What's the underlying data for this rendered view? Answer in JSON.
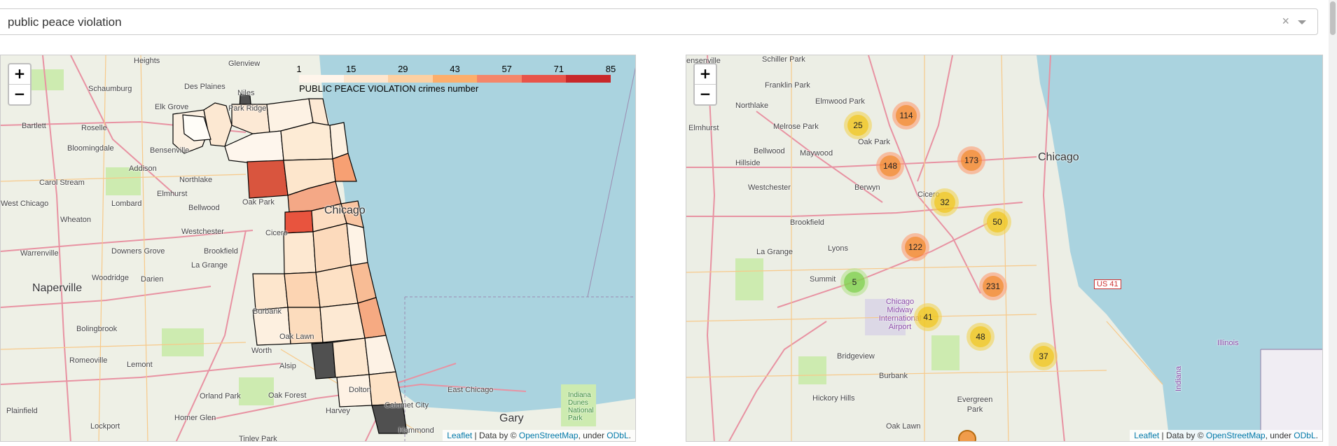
{
  "select": {
    "value": "public peace violation",
    "clear": "×"
  },
  "map_left": {
    "legend": {
      "ticks": [
        "1",
        "15",
        "29",
        "43",
        "57",
        "71",
        "85"
      ],
      "caption": "PUBLIC PEACE VIOLATION crimes number",
      "colors": [
        "#fff5eb",
        "#fee6ce",
        "#fdd0a2",
        "#fdae6b",
        "#f4866a",
        "#e8544a",
        "#c8282a"
      ]
    },
    "zoom_in": "+",
    "zoom_out": "−",
    "places": [
      "Heights",
      "Glenview",
      "Schaumburg",
      "Des Plaines",
      "Niles",
      "Bartlett",
      "Roselle",
      "Elk Grove",
      "Park Ridge",
      "Bloomingdale",
      "Bensenville",
      "Addison",
      "Carol Stream",
      "Northlake",
      "Elmhurst",
      "Oak Park",
      "West Chicago",
      "Lombard",
      "Bellwood",
      "Chicago",
      "Wheaton",
      "Westchester",
      "Cicero",
      "Warrenville",
      "Downers Grove",
      "Brookfield",
      "La Grange",
      "Naperville",
      "Woodridge",
      "Darien",
      "Burbank",
      "Bolingbrook",
      "Oak Lawn",
      "Romeoville",
      "Lemont",
      "Worth",
      "Orland Park",
      "Alsip",
      "Oak Forest",
      "Harvey",
      "Dolton",
      "East Chicago",
      "Calumet City",
      "Plainfield",
      "Lockport",
      "Homer Glen",
      "Gary",
      "Hammond",
      "Tinley Park",
      "Indiana Dunes National Park"
    ],
    "attribution": {
      "leaflet": "Leaflet",
      "mid": " | Data by © ",
      "osm": "OpenStreetMap",
      "under": ", under ",
      "odbl": "ODbL",
      "end": "."
    }
  },
  "map_right": {
    "zoom_in": "+",
    "zoom_out": "−",
    "clusters": [
      {
        "label": "25",
        "size": "med"
      },
      {
        "label": "114",
        "size": "large"
      },
      {
        "label": "148",
        "size": "large"
      },
      {
        "label": "173",
        "size": "large"
      },
      {
        "label": "32",
        "size": "med"
      },
      {
        "label": "50",
        "size": "med"
      },
      {
        "label": "122",
        "size": "large"
      },
      {
        "label": "5",
        "size": "small"
      },
      {
        "label": "231",
        "size": "large"
      },
      {
        "label": "41",
        "size": "med"
      },
      {
        "label": "48",
        "size": "med"
      },
      {
        "label": "37",
        "size": "med"
      }
    ],
    "places": [
      "ensenville",
      "Schiller Park",
      "Franklin Park",
      "Northlake",
      "Elmwood Park",
      "Melrose Park",
      "Elmhurst",
      "Oak Park",
      "Bellwood",
      "Maywood",
      "Hillside",
      "Chicago",
      "Westchester",
      "Berwyn",
      "Cicero",
      "Brookfield",
      "Lyons",
      "La Grange",
      "Summit",
      "Chicago Midway International Airport",
      "Bridgeview",
      "Burbank",
      "Hickory Hills",
      "Evergreen Park",
      "Oak Lawn",
      "Illinois",
      "Indiana",
      "US 41"
    ],
    "attribution": {
      "leaflet": "Leaflet",
      "mid": " | Data by © ",
      "osm": "OpenStreetMap",
      "under": ", under ",
      "odbl": "ODbL",
      "end": "."
    }
  }
}
